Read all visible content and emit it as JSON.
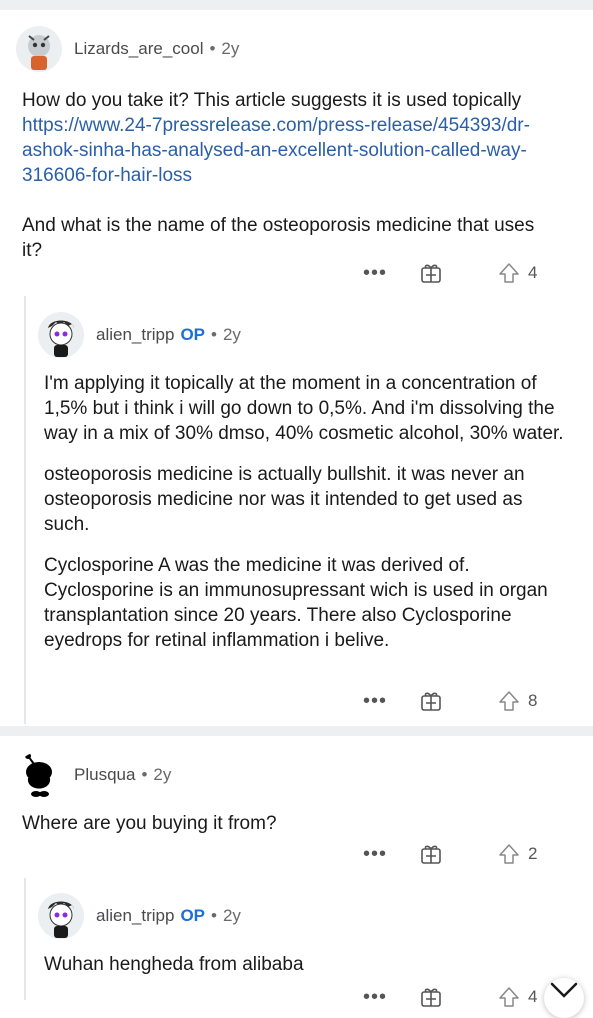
{
  "comments": [
    {
      "username": "Lizards_are_cool",
      "age": "2y",
      "body": "How do you take it? This article suggests it is used topically",
      "link": "https://www.24-7pressrelease.com/press-release/454393/dr-ashok-sinha-has-analysed-an-excellent-solution-called-way-316606-for-hair-loss",
      "body2": "And what is the name of the osteoporosis medicine that uses it?",
      "votes": "4"
    },
    {
      "username": "alien_tripp",
      "op": "OP",
      "age": "2y",
      "paragraphs": [
        "I'm applying it topically at the moment in a concentration of 1,5% but i think i will go down to 0,5%. And i'm dissolving the way in a mix of 30% dmso, 40% cosmetic alcohol, 30% water.",
        "osteoporosis medicine is actually bullshit. it was never an osteoporosis medicine nor was it intended to get used as such.",
        "Cyclosporine A was the medicine it was derived of. Cyclosporine is an immunosupressant wich is used in organ transplantation since 20 years. There also Cyclosporine eyedrops for retinal inflammation i belive."
      ],
      "votes": "8"
    },
    {
      "username": "Plusqua",
      "age": "2y",
      "body": "Where are you buying it from?",
      "votes": "2"
    },
    {
      "username": "alien_tripp",
      "op": "OP",
      "age": "2y",
      "body": "Wuhan hengheda from alibaba",
      "votes": "4"
    }
  ],
  "ui": {
    "dot": "•",
    "more": "•••"
  },
  "icons": {
    "more": "more-options-icon",
    "award": "award-icon",
    "upvote": "upvote-arrow-icon",
    "collapse": "collapse-chevron-icon"
  },
  "colors": {
    "link": "#2a5fa8",
    "op_badge": "#1b6fd6",
    "separator": "#edeff1",
    "thread_line": "#e4e6e8"
  }
}
